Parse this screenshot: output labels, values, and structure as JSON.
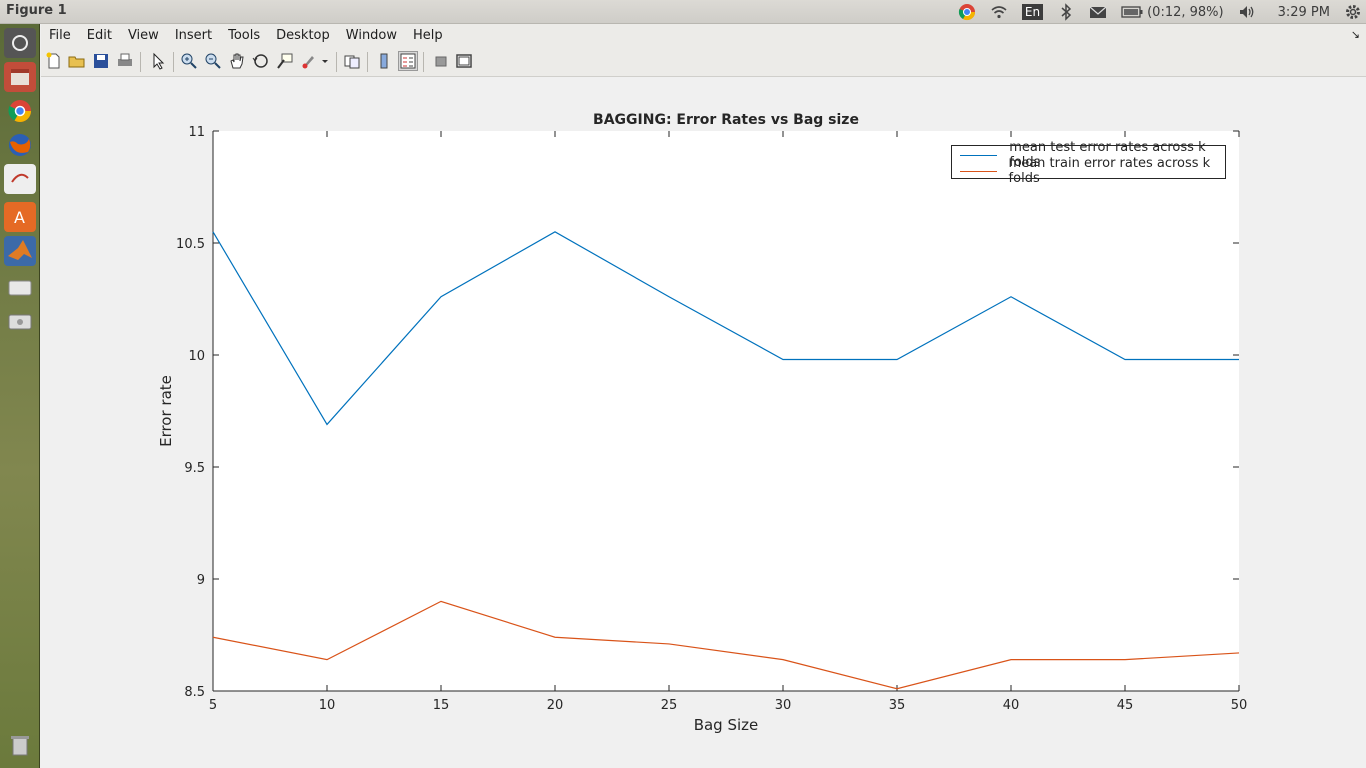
{
  "window": {
    "title": "Figure 1"
  },
  "tray": {
    "battery": "(0:12, 98%)",
    "keyboard": "En",
    "time": "3:29 PM"
  },
  "menu": [
    "File",
    "Edit",
    "View",
    "Insert",
    "Tools",
    "Desktop",
    "Window",
    "Help"
  ],
  "colors": {
    "series1": "#0072bd",
    "series2": "#d95319",
    "axes_bg": "#ffffff",
    "figure_bg": "#f0f0f0"
  },
  "chart_data": {
    "type": "line",
    "title": "BAGGING: Error Rates vs Bag size",
    "xlabel": "Bag Size",
    "ylabel": "Error rate",
    "xlim": [
      5,
      50
    ],
    "ylim": [
      8.5,
      11
    ],
    "xticks": [
      "5",
      "10",
      "15",
      "20",
      "25",
      "30",
      "35",
      "40",
      "45",
      "50"
    ],
    "yticks": [
      "8.5",
      "9",
      "9.5",
      "10",
      "10.5",
      "11"
    ],
    "x": [
      5,
      10,
      15,
      20,
      25,
      30,
      35,
      40,
      45,
      50
    ],
    "series": [
      {
        "name": "mean test error rates across k folds",
        "values": [
          10.55,
          9.69,
          10.26,
          10.55,
          10.26,
          9.98,
          9.98,
          10.26,
          9.98,
          9.98
        ]
      },
      {
        "name": "mean train error rates across k folds",
        "values": [
          8.74,
          8.64,
          8.9,
          8.74,
          8.71,
          8.64,
          8.51,
          8.64,
          8.64,
          8.67
        ]
      }
    ],
    "legend": "top-right",
    "grid": false
  }
}
